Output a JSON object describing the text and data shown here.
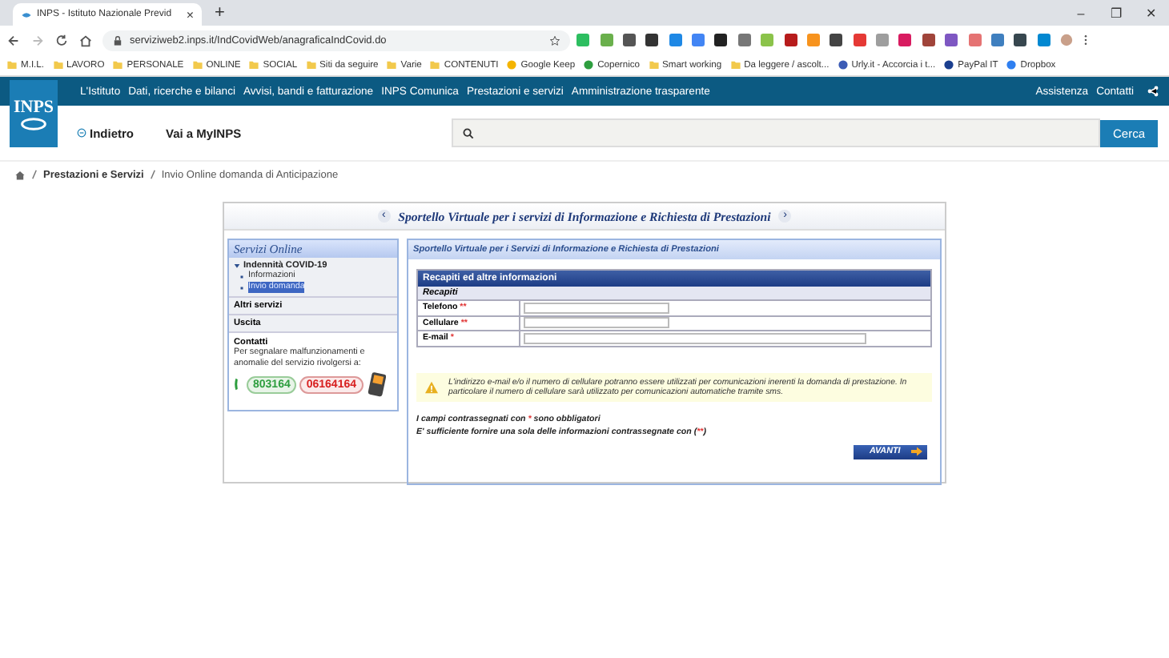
{
  "browser": {
    "tab_title": "INPS - Istituto Nazionale Previd",
    "close": "×",
    "new_tab": "+",
    "url": "serviziweb2.inps.it/IndCovidWeb/anagraficaIndCovid.do",
    "window_controls": [
      "–",
      "❐",
      "✕"
    ],
    "bookmarks": [
      {
        "label": "M.I.L.",
        "kind": "folder"
      },
      {
        "label": "LAVORO",
        "kind": "folder"
      },
      {
        "label": "PERSONALE",
        "kind": "folder"
      },
      {
        "label": "ONLINE",
        "kind": "folder"
      },
      {
        "label": "SOCIAL",
        "kind": "folder"
      },
      {
        "label": "Siti da seguire",
        "kind": "folder"
      },
      {
        "label": "Varie",
        "kind": "folder"
      },
      {
        "label": "CONTENUTI",
        "kind": "folder"
      },
      {
        "label": "Google Keep",
        "kind": "site",
        "color": "#f4b400"
      },
      {
        "label": "Copernico",
        "kind": "site",
        "color": "#2e9e3f"
      },
      {
        "label": "Smart working",
        "kind": "folder"
      },
      {
        "label": "Da leggere / ascolt...",
        "kind": "folder"
      },
      {
        "label": "Urly.it - Accorcia i t...",
        "kind": "site",
        "color": "#3b5bb5"
      },
      {
        "label": "PayPal IT",
        "kind": "site",
        "color": "#1b3f8f"
      },
      {
        "label": "Dropbox",
        "kind": "site",
        "color": "#2f7ff0"
      }
    ],
    "extensions": [
      {
        "color": "#2dbe60"
      },
      {
        "color": "#6ab04c"
      },
      {
        "color": "#555555"
      },
      {
        "color": "#333333"
      },
      {
        "color": "#1e88e5"
      },
      {
        "color": "#4285f4"
      },
      {
        "color": "#222222"
      },
      {
        "color": "#777777"
      },
      {
        "color": "#8bc34a"
      },
      {
        "color": "#b71c1c"
      },
      {
        "color": "#f7931e"
      },
      {
        "color": "#444444"
      },
      {
        "color": "#e53935"
      },
      {
        "color": "#9e9e9e"
      },
      {
        "color": "#d81b60"
      },
      {
        "color": "#a0443a"
      },
      {
        "color": "#7e57c2"
      },
      {
        "color": "#e57373"
      },
      {
        "color": "#3f7fbf"
      },
      {
        "color": "#37474f"
      },
      {
        "color": "#0288d1"
      }
    ]
  },
  "site": {
    "logo": "INPS",
    "nav": [
      {
        "label": "L'Istituto"
      },
      {
        "label": "Dati, ricerche e bilanci"
      },
      {
        "label": "Avvisi, bandi e fatturazione"
      },
      {
        "label": "INPS Comunica"
      },
      {
        "label": "Prestazioni e servizi"
      },
      {
        "label": "Amministrazione trasparente"
      }
    ],
    "nav_right": [
      {
        "label": "Assistenza"
      },
      {
        "label": "Contatti"
      }
    ],
    "back": "Indietro",
    "myinps": "Vai a MyINPS",
    "search_button": "Cerca",
    "breadcrumb": [
      {
        "label": "Prestazioni e Servizi",
        "kind": "link"
      },
      {
        "label": "Invio Online domanda di Anticipazione",
        "kind": "current"
      }
    ]
  },
  "portal": {
    "title": "Sportello Virtuale per i servizi di Informazione e Richiesta di Prestazioni",
    "prev": "‹",
    "next": "›",
    "sidebar": {
      "title": "Servizi Online",
      "group": "Indennità COVID-19",
      "group_expanded": true,
      "items": [
        {
          "label": "Informazioni",
          "selected": false
        },
        {
          "label": "Invio domanda",
          "selected": true
        }
      ],
      "links": [
        "Altri servizi",
        "Uscita"
      ],
      "contacts_title": "Contatti",
      "contacts_text": "Per segnalare malfunzionamenti e anomalie del servizio rivolgersi a:",
      "green_number": "803164",
      "red_number": "06164164"
    },
    "panel_title": "Sportello Virtuale per i Servizi di Informazione e Richiesta di Prestazioni",
    "form": {
      "title": "Recapiti ed altre informazioni",
      "section": "Recapiti",
      "fields": [
        {
          "label": "Telefono",
          "marker": "**",
          "kind": "short"
        },
        {
          "label": "Cellulare",
          "marker": "**",
          "kind": "short"
        },
        {
          "label": "E-mail",
          "marker": "*",
          "kind": "long"
        }
      ]
    },
    "warning": "L'indirizzo e-mail e/o il numero di cellulare potranno essere utilizzati per comunicazioni inerenti la domanda di prestazione. In particolare il numero di cellulare sarà utilizzato per comunicazioni automatiche tramite sms.",
    "notes": [
      [
        {
          "text": "I campi contrassegnati con ",
          "kind": "plain"
        },
        {
          "text": "*",
          "kind": "required"
        },
        {
          "text": " sono obbligatori",
          "kind": "plain"
        }
      ],
      [
        {
          "text": "E' sufficiente fornire una sola delle informazioni contrassegnate con (",
          "kind": "plain"
        },
        {
          "text": "**",
          "kind": "required"
        },
        {
          "text": ")",
          "kind": "plain"
        }
      ]
    ],
    "submit": "AVANTI"
  }
}
